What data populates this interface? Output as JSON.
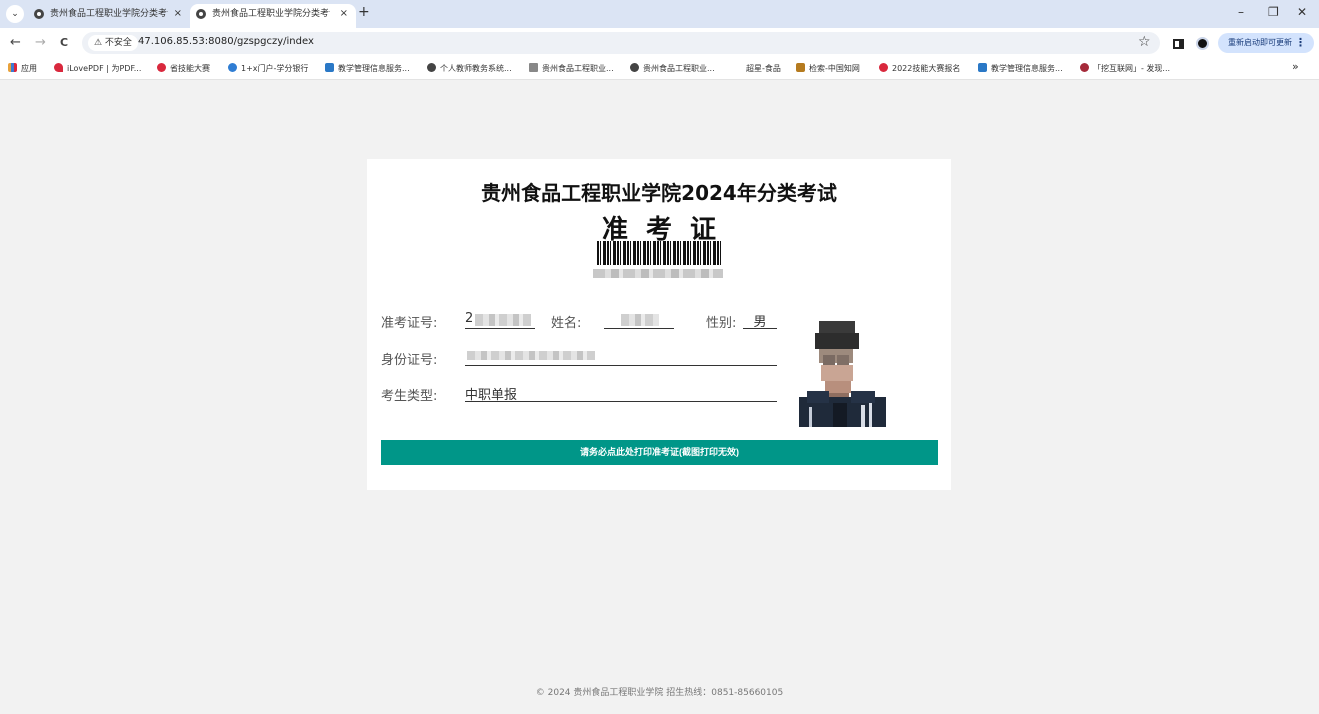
{
  "browser": {
    "tabs": [
      {
        "title": "贵州食品工程职业学院分类考试",
        "active": false
      },
      {
        "title": "贵州食品工程职业学院分类考试",
        "active": true
      }
    ],
    "tab_close": "×",
    "new_tab": "+",
    "window_controls": {
      "minimize": "–",
      "restore": "❐",
      "close": "✕"
    },
    "nav": {
      "back": "←",
      "forward": "→",
      "reload": "C"
    },
    "security_label": "⚠ 不安全",
    "url": "47.106.85.53:8080/gzspgczy/index",
    "bookmark_star": "☆",
    "update_button": "重新启动即可更新",
    "update_menu": "⋮",
    "bookmarks": [
      {
        "label": "应用",
        "color": "#e8a13a"
      },
      {
        "label": "iLovePDF | 为PDF...",
        "color": "#d9283d"
      },
      {
        "label": "省技能大赛",
        "color": "#d9283d"
      },
      {
        "label": "1+x门户-学分银行",
        "color": "#2f7dd3"
      },
      {
        "label": "教学管理信息服务...",
        "color": "#2a78c6"
      },
      {
        "label": "个人教师教务系统...",
        "color": "#444444"
      },
      {
        "label": "贵州食品工程职业...",
        "color": "#888888"
      },
      {
        "label": "贵州食品工程职业...",
        "color": "#444444"
      },
      {
        "label": "超星-食品",
        "color": "#ffffff"
      },
      {
        "label": "检索-中国知网",
        "color": "#b57b1f"
      },
      {
        "label": "2022技能大赛报名",
        "color": "#d9283d"
      },
      {
        "label": "教学管理信息服务...",
        "color": "#2a78c6"
      },
      {
        "label": "「挖互联网」- 发现...",
        "color": "#a52a3a"
      }
    ],
    "bookmarks_more": "»"
  },
  "card": {
    "school_title": "贵州食品工程职业学院2024年分类考试",
    "ticket_title": "准考证",
    "fields": {
      "exam_no_label": "准考证号:",
      "exam_no_value": "2",
      "name_label": "姓名:",
      "gender_label": "性别:",
      "gender_value": "男",
      "id_label": "身份证号:",
      "type_label": "考生类型:",
      "type_value": "中职单报"
    },
    "print_button": "请务必点此处打印准考证(截图打印无效)"
  },
  "footer": "© 2024  贵州食品工程职业学院 招生热线：0851-85660105"
}
